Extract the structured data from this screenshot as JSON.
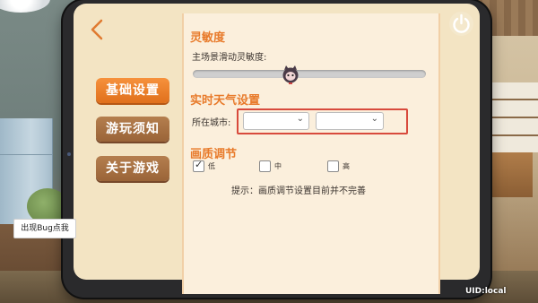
{
  "sidebar": {
    "items": [
      {
        "label": "基础设置",
        "active": true
      },
      {
        "label": "游玩须知",
        "active": false
      },
      {
        "label": "关于游戏",
        "active": false
      }
    ]
  },
  "sensitivity": {
    "title": "灵敏度",
    "label": "主场景滑动灵敏度:",
    "value": 0.43
  },
  "weather": {
    "title": "实时天气设置",
    "city_label": "所在城市:",
    "select1_value": "",
    "select2_value": ""
  },
  "quality": {
    "title": "画质调节",
    "options": [
      {
        "label": "低",
        "checked": true
      },
      {
        "label": "中",
        "checked": false
      },
      {
        "label": "高",
        "checked": false
      }
    ],
    "tip": "提示：画质调节设置目前并不完善"
  },
  "bug_button": "出现Bug点我",
  "uid": "UID:local",
  "icons": {
    "back": "back-arrow-icon",
    "power": "power-icon",
    "knob": "cat-knob-icon",
    "dropdown": "chevron-down-icon",
    "check": "check-icon"
  },
  "colors": {
    "accent": "#e87a2a",
    "active_button": "#f6913c",
    "idle_button": "#a86e42",
    "panel": "#fbefdc",
    "highlight_border": "#d84a3c"
  }
}
